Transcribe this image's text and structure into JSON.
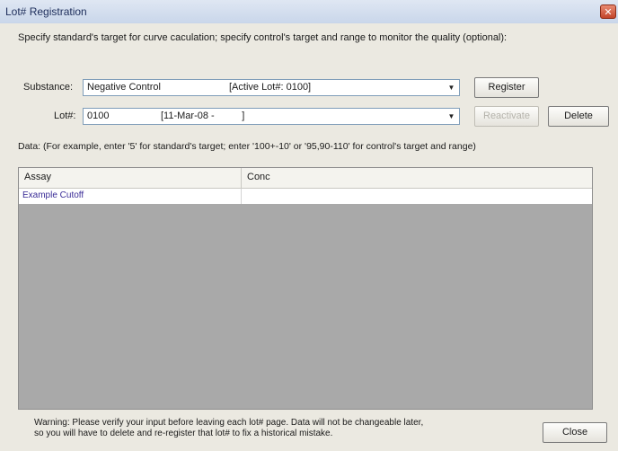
{
  "window": {
    "title": "Lot# Registration",
    "close_glyph": "✕"
  },
  "instruction": "Specify standard's target for curve caculation; specify control's target and range to monitor the quality (optional):",
  "substance": {
    "label": "Substance:",
    "value": "Negative Control",
    "active_lot": "[Active Lot#: 0100]"
  },
  "lot": {
    "label": "Lot#:",
    "value": "0100",
    "date": "[11-Mar-08 -          ]"
  },
  "buttons": {
    "register": "Register",
    "reactivate": "Reactivate",
    "delete": "Delete",
    "close": "Close"
  },
  "data_hint": "Data: (For example, enter '5' for standard's target; enter '100+-10' or '95,90-110' for control's target and range)",
  "table": {
    "columns": [
      "Assay",
      "Conc"
    ],
    "rows": [
      {
        "assay": "Example Cutoff",
        "conc": ""
      }
    ]
  },
  "warning": {
    "line1": "Warning: Please verify your input before leaving each lot# page. Data will not be changeable later,",
    "line2": "so you will have to delete and re-register that lot# to fix a historical mistake."
  },
  "colors": {
    "accent_link": "#3a2c97",
    "window_bg": "#ebe9e1",
    "grid_bg": "#a9a9a9",
    "close_button": "#c2452a"
  }
}
